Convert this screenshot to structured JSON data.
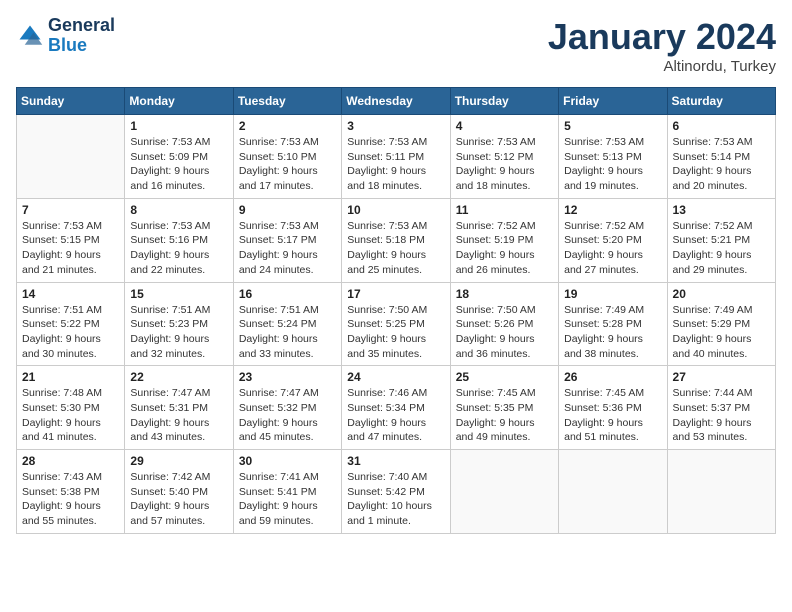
{
  "header": {
    "logo_line1": "General",
    "logo_line2": "Blue",
    "month": "January 2024",
    "location": "Altinordu, Turkey"
  },
  "days_of_week": [
    "Sunday",
    "Monday",
    "Tuesday",
    "Wednesday",
    "Thursday",
    "Friday",
    "Saturday"
  ],
  "weeks": [
    [
      {
        "day": "",
        "sunrise": "",
        "sunset": "",
        "daylight": ""
      },
      {
        "day": "1",
        "sunrise": "Sunrise: 7:53 AM",
        "sunset": "Sunset: 5:09 PM",
        "daylight": "Daylight: 9 hours and 16 minutes."
      },
      {
        "day": "2",
        "sunrise": "Sunrise: 7:53 AM",
        "sunset": "Sunset: 5:10 PM",
        "daylight": "Daylight: 9 hours and 17 minutes."
      },
      {
        "day": "3",
        "sunrise": "Sunrise: 7:53 AM",
        "sunset": "Sunset: 5:11 PM",
        "daylight": "Daylight: 9 hours and 18 minutes."
      },
      {
        "day": "4",
        "sunrise": "Sunrise: 7:53 AM",
        "sunset": "Sunset: 5:12 PM",
        "daylight": "Daylight: 9 hours and 18 minutes."
      },
      {
        "day": "5",
        "sunrise": "Sunrise: 7:53 AM",
        "sunset": "Sunset: 5:13 PM",
        "daylight": "Daylight: 9 hours and 19 minutes."
      },
      {
        "day": "6",
        "sunrise": "Sunrise: 7:53 AM",
        "sunset": "Sunset: 5:14 PM",
        "daylight": "Daylight: 9 hours and 20 minutes."
      }
    ],
    [
      {
        "day": "7",
        "sunrise": "Sunrise: 7:53 AM",
        "sunset": "Sunset: 5:15 PM",
        "daylight": "Daylight: 9 hours and 21 minutes."
      },
      {
        "day": "8",
        "sunrise": "Sunrise: 7:53 AM",
        "sunset": "Sunset: 5:16 PM",
        "daylight": "Daylight: 9 hours and 22 minutes."
      },
      {
        "day": "9",
        "sunrise": "Sunrise: 7:53 AM",
        "sunset": "Sunset: 5:17 PM",
        "daylight": "Daylight: 9 hours and 24 minutes."
      },
      {
        "day": "10",
        "sunrise": "Sunrise: 7:53 AM",
        "sunset": "Sunset: 5:18 PM",
        "daylight": "Daylight: 9 hours and 25 minutes."
      },
      {
        "day": "11",
        "sunrise": "Sunrise: 7:52 AM",
        "sunset": "Sunset: 5:19 PM",
        "daylight": "Daylight: 9 hours and 26 minutes."
      },
      {
        "day": "12",
        "sunrise": "Sunrise: 7:52 AM",
        "sunset": "Sunset: 5:20 PM",
        "daylight": "Daylight: 9 hours and 27 minutes."
      },
      {
        "day": "13",
        "sunrise": "Sunrise: 7:52 AM",
        "sunset": "Sunset: 5:21 PM",
        "daylight": "Daylight: 9 hours and 29 minutes."
      }
    ],
    [
      {
        "day": "14",
        "sunrise": "Sunrise: 7:51 AM",
        "sunset": "Sunset: 5:22 PM",
        "daylight": "Daylight: 9 hours and 30 minutes."
      },
      {
        "day": "15",
        "sunrise": "Sunrise: 7:51 AM",
        "sunset": "Sunset: 5:23 PM",
        "daylight": "Daylight: 9 hours and 32 minutes."
      },
      {
        "day": "16",
        "sunrise": "Sunrise: 7:51 AM",
        "sunset": "Sunset: 5:24 PM",
        "daylight": "Daylight: 9 hours and 33 minutes."
      },
      {
        "day": "17",
        "sunrise": "Sunrise: 7:50 AM",
        "sunset": "Sunset: 5:25 PM",
        "daylight": "Daylight: 9 hours and 35 minutes."
      },
      {
        "day": "18",
        "sunrise": "Sunrise: 7:50 AM",
        "sunset": "Sunset: 5:26 PM",
        "daylight": "Daylight: 9 hours and 36 minutes."
      },
      {
        "day": "19",
        "sunrise": "Sunrise: 7:49 AM",
        "sunset": "Sunset: 5:28 PM",
        "daylight": "Daylight: 9 hours and 38 minutes."
      },
      {
        "day": "20",
        "sunrise": "Sunrise: 7:49 AM",
        "sunset": "Sunset: 5:29 PM",
        "daylight": "Daylight: 9 hours and 40 minutes."
      }
    ],
    [
      {
        "day": "21",
        "sunrise": "Sunrise: 7:48 AM",
        "sunset": "Sunset: 5:30 PM",
        "daylight": "Daylight: 9 hours and 41 minutes."
      },
      {
        "day": "22",
        "sunrise": "Sunrise: 7:47 AM",
        "sunset": "Sunset: 5:31 PM",
        "daylight": "Daylight: 9 hours and 43 minutes."
      },
      {
        "day": "23",
        "sunrise": "Sunrise: 7:47 AM",
        "sunset": "Sunset: 5:32 PM",
        "daylight": "Daylight: 9 hours and 45 minutes."
      },
      {
        "day": "24",
        "sunrise": "Sunrise: 7:46 AM",
        "sunset": "Sunset: 5:34 PM",
        "daylight": "Daylight: 9 hours and 47 minutes."
      },
      {
        "day": "25",
        "sunrise": "Sunrise: 7:45 AM",
        "sunset": "Sunset: 5:35 PM",
        "daylight": "Daylight: 9 hours and 49 minutes."
      },
      {
        "day": "26",
        "sunrise": "Sunrise: 7:45 AM",
        "sunset": "Sunset: 5:36 PM",
        "daylight": "Daylight: 9 hours and 51 minutes."
      },
      {
        "day": "27",
        "sunrise": "Sunrise: 7:44 AM",
        "sunset": "Sunset: 5:37 PM",
        "daylight": "Daylight: 9 hours and 53 minutes."
      }
    ],
    [
      {
        "day": "28",
        "sunrise": "Sunrise: 7:43 AM",
        "sunset": "Sunset: 5:38 PM",
        "daylight": "Daylight: 9 hours and 55 minutes."
      },
      {
        "day": "29",
        "sunrise": "Sunrise: 7:42 AM",
        "sunset": "Sunset: 5:40 PM",
        "daylight": "Daylight: 9 hours and 57 minutes."
      },
      {
        "day": "30",
        "sunrise": "Sunrise: 7:41 AM",
        "sunset": "Sunset: 5:41 PM",
        "daylight": "Daylight: 9 hours and 59 minutes."
      },
      {
        "day": "31",
        "sunrise": "Sunrise: 7:40 AM",
        "sunset": "Sunset: 5:42 PM",
        "daylight": "Daylight: 10 hours and 1 minute."
      },
      {
        "day": "",
        "sunrise": "",
        "sunset": "",
        "daylight": ""
      },
      {
        "day": "",
        "sunrise": "",
        "sunset": "",
        "daylight": ""
      },
      {
        "day": "",
        "sunrise": "",
        "sunset": "",
        "daylight": ""
      }
    ]
  ]
}
